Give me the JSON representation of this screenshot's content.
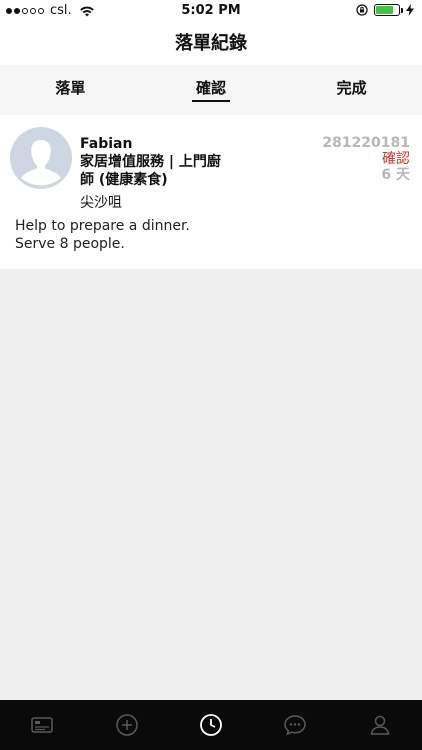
{
  "status_bar": {
    "carrier": "csl.",
    "time": "5:02 PM",
    "signal_bars_filled": 2,
    "signal_bars_total": 5,
    "battery_level": 0.78
  },
  "header": {
    "title": "落單紀錄"
  },
  "tabs": [
    {
      "label": "落單",
      "active": false
    },
    {
      "label": "確認",
      "active": true
    },
    {
      "label": "完成",
      "active": false
    }
  ],
  "order": {
    "customer_name": "Fabian",
    "service_line1": "家居增值服務 | 上門廚",
    "service_line2": "師 (健康素食)",
    "location": "尖沙咀",
    "order_id": "281220181",
    "status": "確認",
    "days": "6 天",
    "description_line1": "Help to prepare a dinner.",
    "description_line2": "Serve 8 people."
  },
  "tabbar": {
    "items": [
      {
        "icon": "card-icon"
      },
      {
        "icon": "plus-circle-icon"
      },
      {
        "icon": "clock-icon",
        "active": true
      },
      {
        "icon": "chat-icon"
      },
      {
        "icon": "person-icon"
      }
    ]
  },
  "colors": {
    "status_red": "#d9342b",
    "muted_gray": "#b8b8b8",
    "battery_green": "#3fc53f",
    "tabbar_bg": "#0a0a0a",
    "page_bg": "#efefef"
  }
}
